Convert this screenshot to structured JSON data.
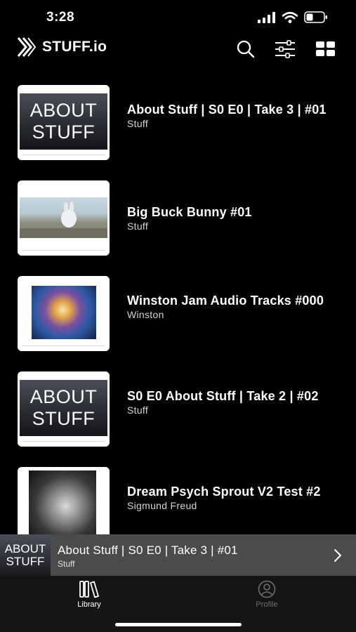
{
  "status_bar": {
    "time": "3:28"
  },
  "header": {
    "brand": "STUFF.io"
  },
  "library": {
    "items": [
      {
        "title": "About Stuff | S0 E0 | Take 3 | #01",
        "author": "Stuff",
        "art": "about",
        "art_text": [
          "ABOUT",
          "STUFF"
        ]
      },
      {
        "title": "Big Buck Bunny #01",
        "author": "Stuff",
        "art": "bunny"
      },
      {
        "title": "Winston Jam Audio Tracks #000",
        "author": "Winston",
        "art": "winston"
      },
      {
        "title": "S0 E0 About Stuff | Take 2 | #02",
        "author": "Stuff",
        "art": "about",
        "art_text": [
          "ABOUT",
          "STUFF"
        ]
      },
      {
        "title": "Dream Psych Sprout V2 Test #2",
        "author": "Sigmund Freud",
        "art": "freud"
      }
    ]
  },
  "mini_player": {
    "title": "About Stuff | S0 E0 | Take 3 |  #01",
    "author": "Stuff",
    "art_text": [
      "ABOUT",
      "STUFF"
    ]
  },
  "tabs": [
    {
      "label": "Library",
      "icon": "library-icon",
      "active": true,
      "color": "#ffffff"
    },
    {
      "label": "Profile",
      "icon": "profile-icon",
      "active": false,
      "color": "#6e6e6e"
    }
  ]
}
